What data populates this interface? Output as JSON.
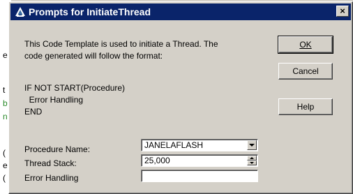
{
  "dialog": {
    "title": "Prompts for InitiateThread",
    "close_glyph": "×",
    "description": [
      "This Code Template is used to initiate a Thread.  The",
      "code generated will follow the format:"
    ],
    "format_lines": [
      "IF NOT START(Procedure)",
      "  Error Handling",
      "END"
    ]
  },
  "buttons": {
    "ok_label": "OK",
    "cancel_label": "Cancel",
    "help_label": "Help"
  },
  "fields": {
    "procedure_name": {
      "label": "Procedure Name:",
      "value": "JANELAFLASH"
    },
    "thread_stack": {
      "label": "Thread Stack:",
      "value": "25,000"
    },
    "error_handling": {
      "label": "Error Handling",
      "value": ""
    }
  },
  "background": {
    "edge_chars": [
      "e",
      "t",
      "b",
      "n",
      "(",
      "e",
      "("
    ]
  },
  "icons": {
    "title_icon": "clarion-app-icon",
    "dropdown": "chevron-down-icon",
    "spinner": "spin-up-down-icon"
  },
  "colors": {
    "titlebar": "#0a246a",
    "face": "#d4d0c8"
  }
}
